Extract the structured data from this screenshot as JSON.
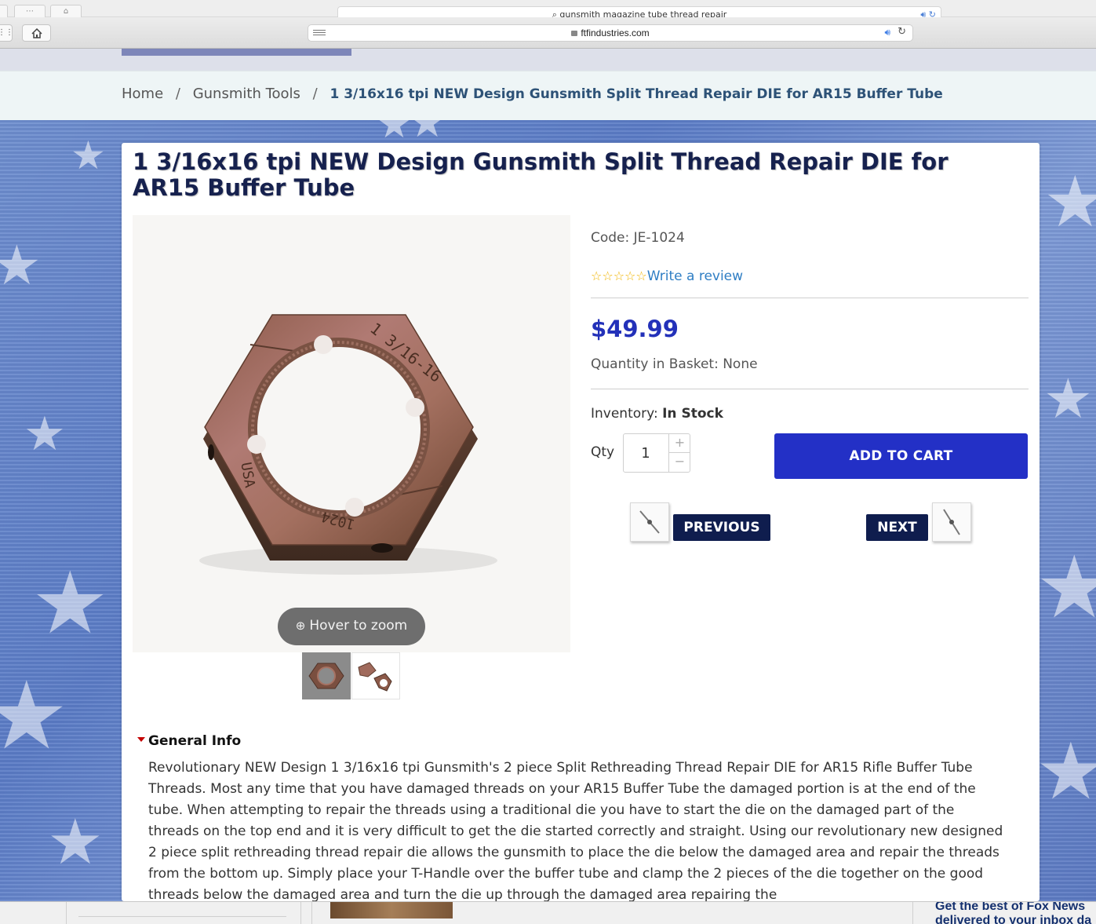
{
  "browser": {
    "background_url": "gunsmith magazine tube thread repair",
    "url": "ftfindustries.com"
  },
  "breadcrumb": {
    "home": "Home",
    "category": "Gunsmith Tools",
    "current": "1 3/16x16 tpi NEW Design Gunsmith Split Thread Repair DIE for AR15 Buffer Tube",
    "separator": "/"
  },
  "product": {
    "title": "1 3/16x16 tpi NEW Design Gunsmith Split Thread Repair DIE for AR15 Buffer Tube",
    "code": "Code: JE-1024",
    "rating_stars": "☆☆☆☆☆",
    "review_link": "Write a review",
    "price": "$49.99",
    "basket": "Quantity in Basket: None",
    "inventory_label": "Inventory:",
    "inventory_status": "In Stock",
    "qty_label": "Qty",
    "qty_value": "1",
    "qty_plus": "+",
    "qty_minus": "−",
    "add_to_cart": "ADD TO CART",
    "hover_zoom": "Hover to zoom",
    "die_markings": {
      "size": "1 3/16-16",
      "origin": "USA",
      "part": "1024"
    }
  },
  "navigation": {
    "previous": "PREVIOUS",
    "next": "NEXT"
  },
  "general_info": {
    "heading": "General Info",
    "text": "Revolutionary NEW Design 1 3/16x16 tpi Gunsmith's 2 piece Split Rethreading Thread Repair DIE for AR15 Rifle Buffer Tube Threads. Most any time that you have damaged threads on your AR15 Buffer Tube the damaged portion is at the end of the tube. When attempting to repair the threads using a traditional die you have to start the die on the damaged part of the threads on the top end and it is very difficult to get the die started correctly and straight. Using our revolutionary new designed 2 piece split rethreading thread repair die allows the gunsmith to place the die below the damaged area and repair the threads from the bottom up. Simply place your T-Handle over the buffer tube and clamp the 2 pieces of the die together on the good threads below the damaged area and turn the die up through the damaged area repairing the"
  },
  "bottom_peek": {
    "text_line1": "Get the best of Fox News",
    "text_line2": "delivered to your inbox da"
  },
  "colors": {
    "title": "#16214e",
    "price": "#2331b9",
    "add_to_cart_bg": "#2330c6",
    "nav_button_bg": "#0f1d4e",
    "link": "#2f7ec4",
    "star": "#f0b400"
  }
}
